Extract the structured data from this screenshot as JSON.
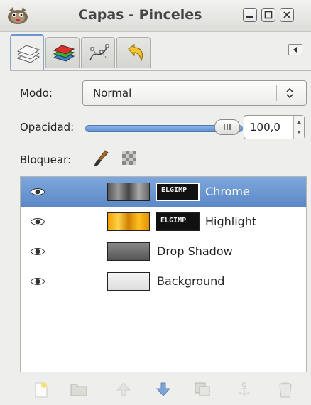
{
  "window": {
    "title": "Capas - Pinceles",
    "icons": [
      "gimp-app-icon",
      "minimize-icon",
      "maximize-icon",
      "close-icon"
    ]
  },
  "tabs": [
    {
      "name": "layers",
      "icon": "layers-icon",
      "active": true
    },
    {
      "name": "channels",
      "icon": "channels-icon",
      "active": false
    },
    {
      "name": "paths",
      "icon": "paths-icon",
      "active": false
    },
    {
      "name": "undo-history",
      "icon": "undo-history-icon",
      "active": false
    }
  ],
  "form": {
    "mode_label": "Modo:",
    "mode_value": "Normal",
    "opacity_label": "Opacidad:",
    "opacity_value": "100,0",
    "opacity_fraction": 1.0,
    "lock_label": "Bloquear:"
  },
  "layers": [
    {
      "name": "Chrome",
      "selected": true,
      "visible": true,
      "has_mask": true
    },
    {
      "name": "Highlight",
      "selected": false,
      "visible": true,
      "has_mask": true
    },
    {
      "name": "Drop Shadow",
      "selected": false,
      "visible": true,
      "has_mask": false
    },
    {
      "name": "Background",
      "selected": false,
      "visible": true,
      "has_mask": false
    }
  ],
  "mask_text": "ELGIMP",
  "toolbar": [
    "new-layer-icon",
    "new-layer-group-icon",
    "raise-layer-icon",
    "lower-layer-icon",
    "duplicate-layer-icon",
    "anchor-layer-icon",
    "delete-layer-icon"
  ],
  "colors": {
    "selection": "#5b88c6",
    "accent": "#6a97cf"
  }
}
